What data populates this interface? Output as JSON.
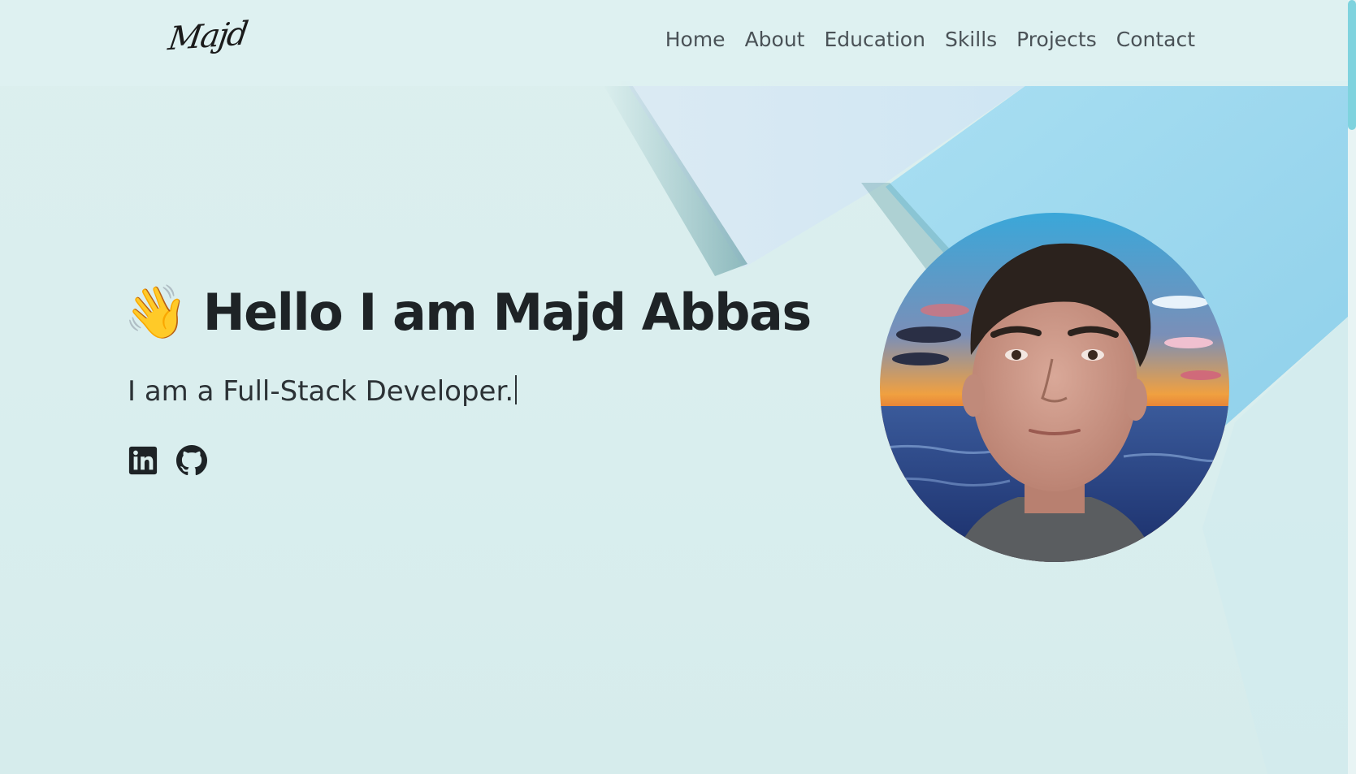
{
  "header": {
    "logo_text": "Majd",
    "nav": [
      {
        "label": "Home"
      },
      {
        "label": "About"
      },
      {
        "label": "Education"
      },
      {
        "label": "Skills"
      },
      {
        "label": "Projects"
      },
      {
        "label": "Contact"
      }
    ]
  },
  "hero": {
    "wave_emoji": "👋",
    "title": "Hello I am Majd Abbas",
    "subtitle": "I am a Full-Stack Developer.",
    "socials": [
      {
        "icon": "linkedin-icon"
      },
      {
        "icon": "github-icon"
      }
    ]
  },
  "colors": {
    "background": "#dcefee",
    "accent_blue": "#9fd8ef",
    "text_dark": "#1e2326",
    "nav_text": "#4a5257",
    "scroll_thumb": "#7fd3de"
  }
}
